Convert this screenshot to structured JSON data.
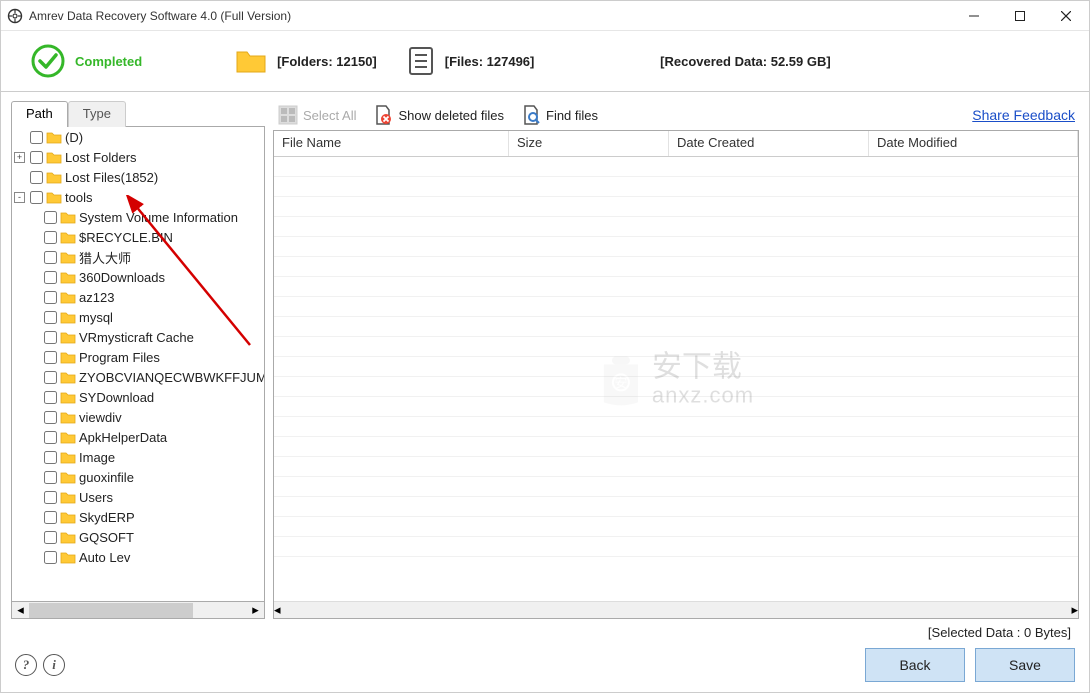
{
  "window": {
    "title": "Amrev Data Recovery Software 4.0 (Full Version)"
  },
  "header": {
    "status": "Completed",
    "folders_label": "[Folders: 12150]",
    "files_label": "[Files: 127496]",
    "recovered_label": "[Recovered Data: 52.59 GB]"
  },
  "tabs": {
    "path": "Path",
    "type": "Type"
  },
  "tree": [
    {
      "indent": 0,
      "expander": "",
      "label": "(D)"
    },
    {
      "indent": 0,
      "expander": "+",
      "label": "Lost Folders"
    },
    {
      "indent": 0,
      "expander": "",
      "label": "Lost Files(1852)"
    },
    {
      "indent": 0,
      "expander": "-",
      "label": "tools"
    },
    {
      "indent": 1,
      "expander": "",
      "label": "System Volume Information"
    },
    {
      "indent": 1,
      "expander": "",
      "label": "$RECYCLE.BIN"
    },
    {
      "indent": 1,
      "expander": "",
      "label": "猎人大师"
    },
    {
      "indent": 1,
      "expander": "",
      "label": "360Downloads"
    },
    {
      "indent": 1,
      "expander": "",
      "label": "az123"
    },
    {
      "indent": 1,
      "expander": "",
      "label": "mysql"
    },
    {
      "indent": 1,
      "expander": "",
      "label": "VRmysticraft Cache"
    },
    {
      "indent": 1,
      "expander": "",
      "label": "Program Files"
    },
    {
      "indent": 1,
      "expander": "",
      "label": "ZYOBCVIANQECWBWKFFJUMX"
    },
    {
      "indent": 1,
      "expander": "",
      "label": "SYDownload"
    },
    {
      "indent": 1,
      "expander": "",
      "label": "viewdiv"
    },
    {
      "indent": 1,
      "expander": "",
      "label": "ApkHelperData"
    },
    {
      "indent": 1,
      "expander": "",
      "label": "Image"
    },
    {
      "indent": 1,
      "expander": "",
      "label": "guoxinfile"
    },
    {
      "indent": 1,
      "expander": "",
      "label": "Users"
    },
    {
      "indent": 1,
      "expander": "",
      "label": "SkydERP"
    },
    {
      "indent": 1,
      "expander": "",
      "label": "GQSOFT"
    },
    {
      "indent": 1,
      "expander": "",
      "label": "Auto Lev"
    }
  ],
  "toolbar": {
    "select_all": "Select All",
    "show_deleted": "Show deleted files",
    "find_files": "Find files",
    "share": "Share Feedback"
  },
  "grid": {
    "columns": {
      "name": "File Name",
      "size": "Size",
      "created": "Date Created",
      "modified": "Date Modified"
    }
  },
  "watermark": {
    "text1": "安下载",
    "text2": "anxz.com"
  },
  "footer": {
    "selected": "[Selected Data : 0 Bytes]",
    "back": "Back",
    "save": "Save"
  }
}
